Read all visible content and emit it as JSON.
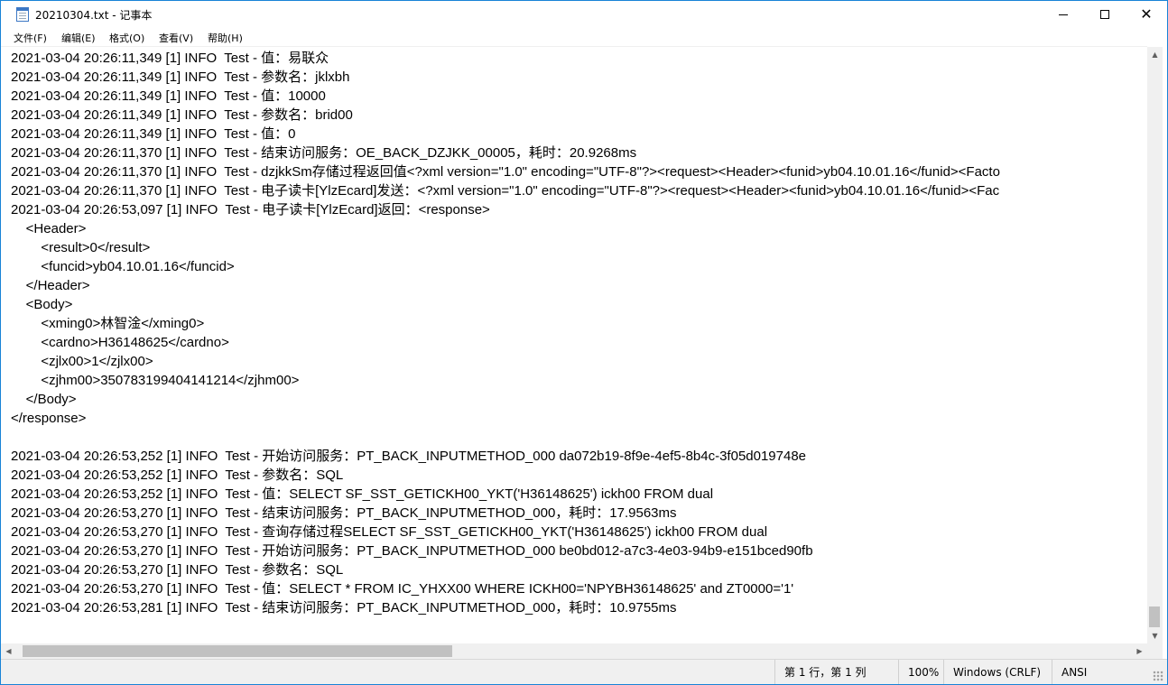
{
  "window": {
    "title": "20210304.txt - 记事本",
    "minimize_label": "—",
    "maximize_label": "☐",
    "close_label": "✕"
  },
  "menu": {
    "file": "文件(F)",
    "edit": "编辑(E)",
    "format": "格式(O)",
    "view": "查看(V)",
    "help": "帮助(H)"
  },
  "editor": {
    "content": "2021-03-04 20:26:11,349 [1] INFO  Test - 值：易联众\n2021-03-04 20:26:11,349 [1] INFO  Test - 参数名：jklxbh\n2021-03-04 20:26:11,349 [1] INFO  Test - 值：10000\n2021-03-04 20:26:11,349 [1] INFO  Test - 参数名：brid00\n2021-03-04 20:26:11,349 [1] INFO  Test - 值：0\n2021-03-04 20:26:11,370 [1] INFO  Test - 结束访问服务：OE_BACK_DZJKK_00005，耗时：20.9268ms\n2021-03-04 20:26:11,370 [1] INFO  Test - dzjkkSm存储过程返回值<?xml version=\"1.0\" encoding=\"UTF-8\"?><request><Header><funid>yb04.10.01.16</funid><Facto\n2021-03-04 20:26:11,370 [1] INFO  Test - 电子读卡[YlzEcard]发送：<?xml version=\"1.0\" encoding=\"UTF-8\"?><request><Header><funid>yb04.10.01.16</funid><Fac\n2021-03-04 20:26:53,097 [1] INFO  Test - 电子读卡[YlzEcard]返回：<response>\n    <Header>\n        <result>0</result>\n        <funcid>yb04.10.01.16</funcid>\n    </Header>\n    <Body>\n        <xming0>林智淦</xming0>\n        <cardno>H36148625</cardno>\n        <zjlx00>1</zjlx00>\n        <zjhm00>350783199404141214</zjhm00>\n    </Body>\n</response>\n\n2021-03-04 20:26:53,252 [1] INFO  Test - 开始访问服务：PT_BACK_INPUTMETHOD_000 da072b19-8f9e-4ef5-8b4c-3f05d019748e\n2021-03-04 20:26:53,252 [1] INFO  Test - 参数名：SQL\n2021-03-04 20:26:53,252 [1] INFO  Test - 值：SELECT SF_SST_GETICKH00_YKT('H36148625') ickh00 FROM dual\n2021-03-04 20:26:53,270 [1] INFO  Test - 结束访问服务：PT_BACK_INPUTMETHOD_000，耗时：17.9563ms\n2021-03-04 20:26:53,270 [1] INFO  Test - 查询存储过程SELECT SF_SST_GETICKH00_YKT('H36148625') ickh00 FROM dual\n2021-03-04 20:26:53,270 [1] INFO  Test - 开始访问服务：PT_BACK_INPUTMETHOD_000 be0bd012-a7c3-4e03-94b9-e151bced90fb\n2021-03-04 20:26:53,270 [1] INFO  Test - 参数名：SQL\n2021-03-04 20:26:53,270 [1] INFO  Test - 值：SELECT * FROM IC_YHXX00 WHERE ICKH00='NPYBH36148625' and ZT0000='1'\n2021-03-04 20:26:53,281 [1] INFO  Test - 结束访问服务：PT_BACK_INPUTMETHOD_000，耗时：10.9755ms"
  },
  "status": {
    "position": "第 1 行，第 1 列",
    "zoom": "100%",
    "line_ending": "Windows (CRLF)",
    "encoding": "ANSI"
  },
  "icons": {
    "app": "notepad-icon",
    "scroll_up": "▲",
    "scroll_down": "▼",
    "scroll_left": "◀",
    "scroll_right": "▶"
  },
  "colors": {
    "window_border": "#1883d7",
    "scrollbar_track": "#f0f0f0",
    "scrollbar_thumb": "#c1c1c1"
  }
}
